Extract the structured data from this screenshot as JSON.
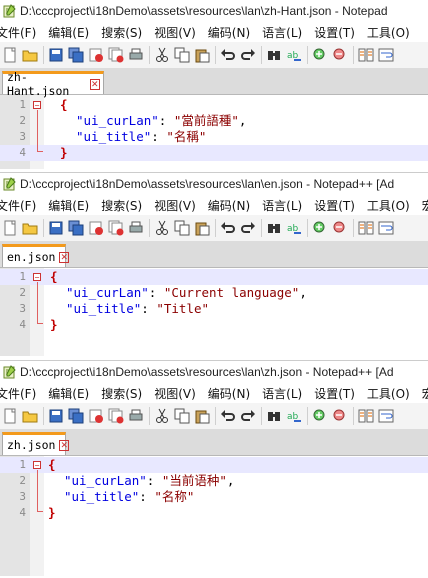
{
  "menu": [
    "文件(F)",
    "编辑(E)",
    "搜索(S)",
    "视图(V)",
    "编码(N)",
    "语言(L)",
    "设置(T)",
    "工具(O)",
    "宏"
  ],
  "windows": [
    {
      "title": "D:\\cccproject\\i18nDemo\\assets\\resources\\lan\\zh-Hant.json - Notepad",
      "tab": "zh-Hant.json",
      "line_numbers": [
        "1",
        "2",
        "3",
        "4"
      ],
      "open_brace": "{",
      "close_brace": "}",
      "entries": [
        {
          "key": "\"ui_curLan\"",
          "sep": ": ",
          "value": "\"當前語種\"",
          "end": ","
        },
        {
          "key": "\"ui_title\"",
          "sep": ": ",
          "value": "\"名稱\"",
          "end": ""
        }
      ]
    },
    {
      "title": "D:\\cccproject\\i18nDemo\\assets\\resources\\lan\\en.json - Notepad++ [Ad",
      "tab": "en.json",
      "line_numbers": [
        "1",
        "2",
        "3",
        "4"
      ],
      "open_brace": "{",
      "close_brace": "}",
      "entries": [
        {
          "key": "\"ui_curLan\"",
          "sep": ": ",
          "value": "\"Current language\"",
          "end": ","
        },
        {
          "key": "\"ui_title\"",
          "sep": ": ",
          "value": "\"Title\"",
          "end": ""
        }
      ]
    },
    {
      "title": "D:\\cccproject\\i18nDemo\\assets\\resources\\lan\\zh.json - Notepad++ [Ad",
      "tab": "zh.json",
      "line_numbers": [
        "1",
        "2",
        "3",
        "4"
      ],
      "open_brace": "{",
      "close_brace": "}",
      "entries": [
        {
          "key": "\"ui_curLan\"",
          "sep": ": ",
          "value": "\"当前语种\"",
          "end": ","
        },
        {
          "key": "\"ui_title\"",
          "sep": ": ",
          "value": "\"名称\"",
          "end": ""
        }
      ]
    }
  ],
  "toolbar_icons": [
    "new-file-icon",
    "open-file-icon",
    "save-icon",
    "save-all-icon",
    "close-icon",
    "close-all-icon",
    "print-icon",
    "cut-icon",
    "copy-icon",
    "paste-icon",
    "undo-icon",
    "redo-icon",
    "find-icon",
    "replace-icon",
    "zoom-in-icon",
    "zoom-out-icon",
    "sync-icon",
    "wrap-icon"
  ],
  "colors": {
    "tab_accent": "#f39a1c",
    "key": "#0000e0",
    "string": "#8b0000",
    "brace": "#c00000",
    "current_line": "#e8e8ff"
  }
}
